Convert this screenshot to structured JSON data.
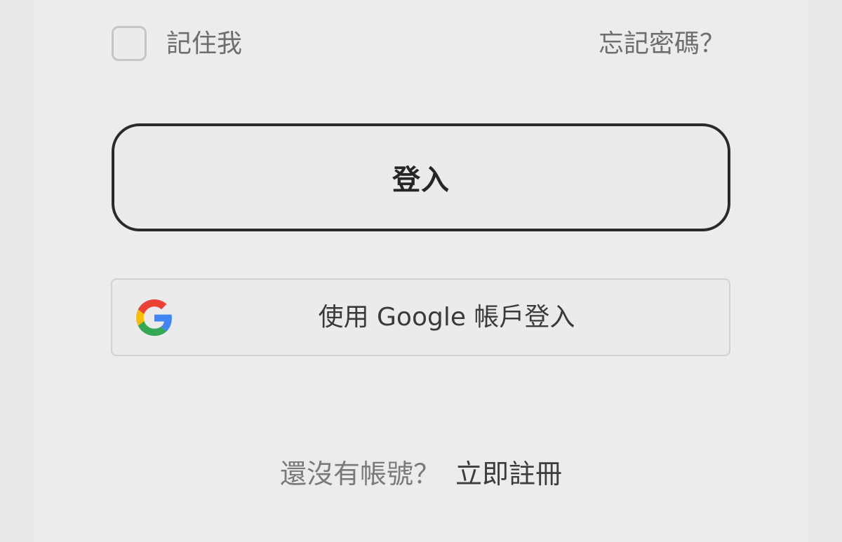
{
  "remember": {
    "label": "記住我",
    "checked": false
  },
  "forgot_password": {
    "label": "忘記密碼？"
  },
  "login_button": {
    "label": "登入"
  },
  "google_button": {
    "label": "使用 Google 帳戶登入",
    "icon": "google-g-icon",
    "icon_colors": {
      "blue": "#4285F4",
      "red": "#EA4335",
      "yellow": "#FBBC05",
      "green": "#34A853"
    }
  },
  "signup": {
    "prompt": "還沒有帳號？",
    "link": "立即註冊"
  },
  "colors": {
    "background": "#ececec",
    "primary_border": "#2a2a2a",
    "muted_text": "#6e6e6e"
  }
}
